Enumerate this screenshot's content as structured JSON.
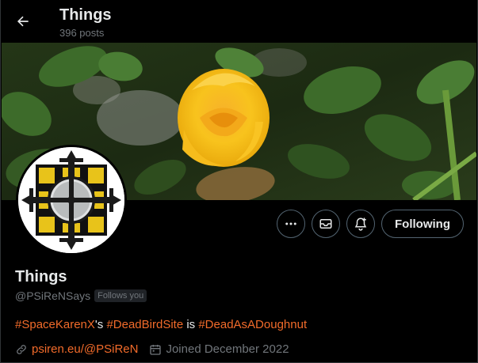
{
  "header": {
    "title": "Things",
    "posts_count": "396 posts",
    "back_icon": "arrow-left-icon"
  },
  "banner": {
    "description_icon": "banner-image"
  },
  "actions": {
    "more_icon": "more-horizontal-icon",
    "message_icon": "envelope-icon",
    "subscribe_icon": "bell-plus-icon",
    "following_label": "Following"
  },
  "profile": {
    "name": "Things",
    "handle": "@PSiReNSays",
    "follows_you": "Follows you",
    "bio": {
      "tag1": "#SpaceKarenX",
      "text1": "'s ",
      "tag2": "#DeadBirdSite",
      "text2": " is ",
      "tag3": "#DeadAsADoughnut"
    },
    "website": "psiren.eu/@PSiReN",
    "joined": "Joined December 2022"
  },
  "colors": {
    "accent": "#f26b2a",
    "muted": "#71767b",
    "border": "#536471",
    "background": "#000000"
  }
}
